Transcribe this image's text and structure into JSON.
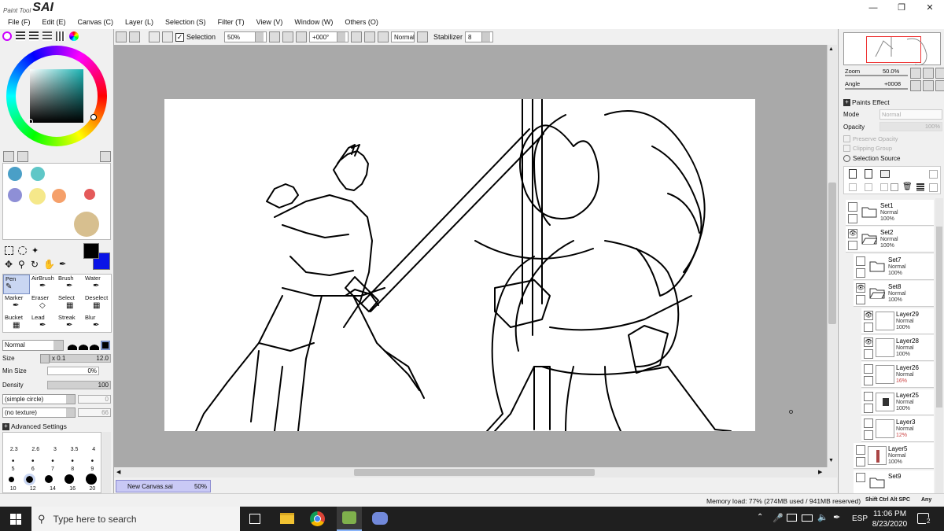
{
  "app": {
    "logo_small": "Paint Tool",
    "logo_big": "SAI",
    "min_icon": "minimize-icon",
    "max_icon": "restore-icon",
    "close_icon": "close-icon"
  },
  "menu": [
    "File (F)",
    "Edit (E)",
    "Canvas (C)",
    "Layer (L)",
    "Selection (S)",
    "Filter (T)",
    "View (V)",
    "Window (W)",
    "Others (O)"
  ],
  "toolbar": {
    "selection_label": "Selection",
    "selection_checked": true,
    "zoom": "50%",
    "rotation": "+000°",
    "blend_mode": "Normal",
    "stabilizer_label": "Stabilizer",
    "stabilizer_value": "8"
  },
  "tools": {
    "row1": [
      "Pen",
      "AirBrush",
      "Brush",
      "Water"
    ],
    "row2": [
      "Marker",
      "Eraser",
      "Select",
      "Deselect"
    ],
    "row3": [
      "Bucket",
      "Lead",
      "Streak",
      "Blur"
    ],
    "selected": "Pen"
  },
  "brush": {
    "mode": "Normal",
    "size_label": "Size",
    "size_mult": "x 0.1",
    "size_value": "12.0",
    "min_size_label": "Min Size",
    "min_size_value": "0%",
    "density_label": "Density",
    "density_value": "100",
    "shape": "(simple circle)",
    "shape_value": "0",
    "texture": "(no texture)",
    "texture_value": "66",
    "advanced_label": "Advanced Settings",
    "sizes_row1": [
      "2.3",
      "2.6",
      "3",
      "3.5",
      "4"
    ],
    "sizes_row2": [
      "5",
      "6",
      "7",
      "8",
      "9"
    ],
    "sizes_row3": [
      "10",
      "12",
      "14",
      "16",
      "20"
    ],
    "selected_size": "12"
  },
  "swatches": [
    "#4a9fc7",
    "#5fc7c7",
    "#8e8fd6",
    "#f5e88a",
    "#f5a06a",
    "#e45a5a",
    "#d7bf8f"
  ],
  "colors": {
    "primary": "#000000",
    "secondary": "#0a14e6"
  },
  "navigator": {
    "zoom_label": "Zoom",
    "zoom_value": "50.0%",
    "angle_label": "Angle",
    "angle_value": "+0008"
  },
  "paint_effect": {
    "title": "Paints Effect",
    "mode_label": "Mode",
    "mode_value": "Normal",
    "opacity_label": "Opacity",
    "opacity_value": "100%",
    "preserve_opacity": "Preserve Opacity",
    "clipping_group": "Clipping Group",
    "selection_source": "Selection Source"
  },
  "layers": [
    {
      "name": "Set1",
      "mode": "Normal",
      "opacity": "100%",
      "type": "folder",
      "visible": false,
      "indent": 0
    },
    {
      "name": "Set2",
      "mode": "Normal",
      "opacity": "100%",
      "type": "folder",
      "visible": true,
      "indent": 0
    },
    {
      "name": "Set7",
      "mode": "Normal",
      "opacity": "100%",
      "type": "folder",
      "visible": false,
      "indent": 1
    },
    {
      "name": "Set8",
      "mode": "Normal",
      "opacity": "100%",
      "type": "folder",
      "visible": true,
      "indent": 1
    },
    {
      "name": "Layer29",
      "mode": "Normal",
      "opacity": "100%",
      "type": "layer",
      "visible": true,
      "indent": 2
    },
    {
      "name": "Layer28",
      "mode": "Normal",
      "opacity": "100%",
      "type": "layer",
      "visible": true,
      "indent": 2
    },
    {
      "name": "Layer26",
      "mode": "Normal",
      "opacity": "16%",
      "type": "layer",
      "visible": false,
      "indent": 2
    },
    {
      "name": "Layer25",
      "mode": "Normal",
      "opacity": "100%",
      "type": "layer",
      "visible": false,
      "indent": 2
    },
    {
      "name": "Layer3",
      "mode": "Normal",
      "opacity": "12%",
      "type": "layer",
      "visible": false,
      "indent": 2
    },
    {
      "name": "Layer5",
      "mode": "Normal",
      "opacity": "100%",
      "type": "layer",
      "visible": false,
      "indent": 1
    },
    {
      "name": "Set9",
      "mode": "",
      "opacity": "",
      "type": "folder",
      "visible": false,
      "indent": 1
    }
  ],
  "canvas_tab": {
    "name": "New Canvas.sai",
    "zoom": "50%"
  },
  "status": {
    "memory": "Memory load: 77% (274MB used / 941MB reserved)",
    "keys": "Shift Ctrl Alt SPC",
    "any": "Any"
  },
  "taskbar": {
    "search_placeholder": "Type here to search",
    "lang": "ESP",
    "time": "11:06 PM",
    "date": "8/23/2020",
    "notif_count": "2"
  }
}
